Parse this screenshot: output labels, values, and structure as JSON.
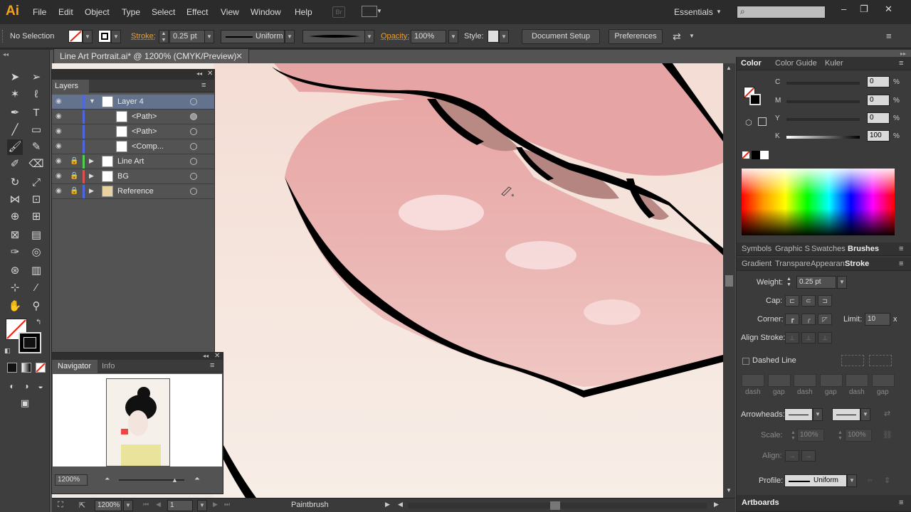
{
  "app": {
    "logo": "Ai",
    "menus": [
      "File",
      "Edit",
      "Object",
      "Type",
      "Select",
      "Effect",
      "View",
      "Window",
      "Help"
    ],
    "bridge_label": "Br",
    "workspace": "Essentials",
    "search_placeholder": ""
  },
  "control_bar": {
    "selection": "No Selection",
    "stroke_label": "Stroke:",
    "stroke_weight": "0.25 pt",
    "profile": "Uniform",
    "opacity_label": "Opacity:",
    "opacity": "100%",
    "style_label": "Style:",
    "document_setup": "Document Setup",
    "preferences": "Preferences"
  },
  "document": {
    "tab_title": "Line Art Portrait.ai* @ 1200% (CMYK/Preview)"
  },
  "layers_panel": {
    "title": "Layers",
    "rows": [
      {
        "name": "Layer 4",
        "color": "#4f67e0",
        "expanded": true,
        "selected": true
      },
      {
        "name": "<Path>",
        "color": "#4f67e0",
        "sub": true
      },
      {
        "name": "<Path>",
        "color": "#4f67e0",
        "sub": true
      },
      {
        "name": "<Comp...",
        "color": "#4f67e0",
        "sub": true
      },
      {
        "name": "Line Art",
        "color": "#4fd04f",
        "locked": true
      },
      {
        "name": "BG",
        "color": "#e04f4f",
        "locked": true
      },
      {
        "name": "Reference",
        "color": "#4f67e0",
        "locked": true
      }
    ]
  },
  "navigator": {
    "tabs": [
      "Navigator",
      "Info"
    ],
    "zoom": "1200%"
  },
  "color_panel": {
    "tabs": [
      "Color",
      "Color Guide",
      "Kuler"
    ],
    "channels": [
      {
        "label": "C",
        "value": "0",
        "unit": "%"
      },
      {
        "label": "M",
        "value": "0",
        "unit": "%"
      },
      {
        "label": "Y",
        "value": "0",
        "unit": "%"
      },
      {
        "label": "K",
        "value": "100",
        "unit": "%"
      }
    ]
  },
  "library_tabs": [
    "Symbols",
    "Graphic S",
    "Swatches",
    "Brushes"
  ],
  "stroke_tabs": [
    "Gradient",
    "Transpare",
    "Appearan",
    "Stroke"
  ],
  "stroke_panel": {
    "weight_label": "Weight:",
    "weight": "0.25 pt",
    "cap_label": "Cap:",
    "corner_label": "Corner:",
    "limit_label": "Limit:",
    "limit": "10",
    "limit_unit": "x",
    "align_label": "Align Stroke:",
    "dashed_label": "Dashed Line",
    "dash_labels": [
      "dash",
      "gap",
      "dash",
      "gap",
      "dash",
      "gap"
    ],
    "arrowheads_label": "Arrowheads:",
    "scale_label": "Scale:",
    "scale_a": "100%",
    "scale_b": "100%",
    "align2_label": "Align:",
    "profile_label": "Profile:",
    "profile": "Uniform"
  },
  "artboards_label": "Artboards",
  "status_bar": {
    "zoom": "1200%",
    "artboard": "1",
    "tool": "Paintbrush"
  },
  "colors": {
    "accent_orange": "#f7a21b",
    "layer_selected": "#63738d"
  }
}
